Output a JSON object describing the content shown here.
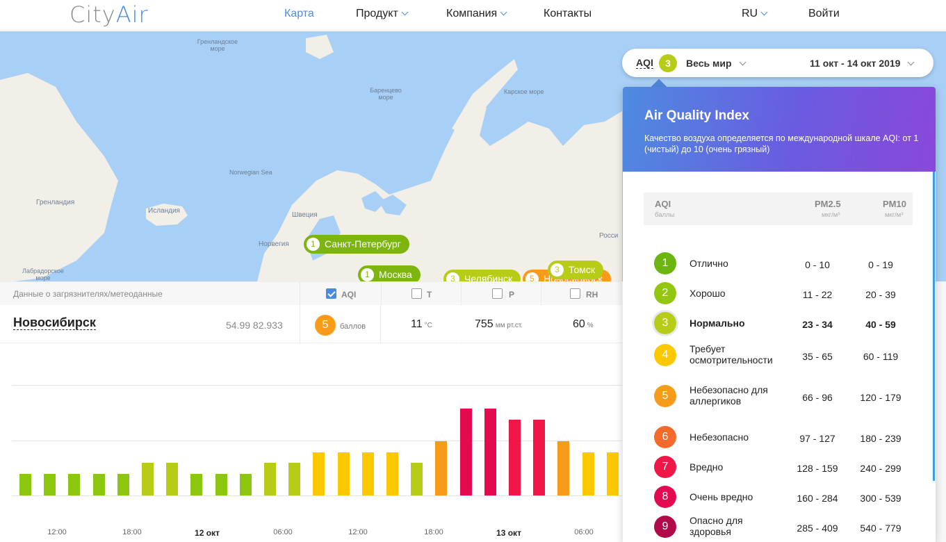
{
  "header": {
    "logo_city": "City",
    "logo_air": "Air",
    "nav": [
      {
        "label": "Карта",
        "active": true
      },
      {
        "label": "Продукт",
        "dropdown": true
      },
      {
        "label": "Компания",
        "dropdown": true
      },
      {
        "label": "Контакты"
      }
    ],
    "lang": "RU",
    "login": "Войти"
  },
  "map": {
    "labels": [
      {
        "text": "Гренландское море"
      },
      {
        "text": "Баренцево море"
      },
      {
        "text": "Карское море"
      },
      {
        "text": "Norwegian Sea"
      },
      {
        "text": "Гренландия"
      },
      {
        "text": "Исландия"
      },
      {
        "text": "Швеция"
      },
      {
        "text": "Норвегия"
      },
      {
        "text": "Лабрадорское море"
      },
      {
        "text": "Росси"
      }
    ],
    "cities": [
      {
        "aqi": "1",
        "name": "Санкт-Петербург",
        "color": "#7cb50f"
      },
      {
        "aqi": "1",
        "name": "Москва",
        "color": "#7cb50f"
      },
      {
        "aqi": "3",
        "name": "Челябинск",
        "color": "#b7cc17"
      },
      {
        "aqi": "3",
        "name": "Томск",
        "color": "#b7cc17"
      },
      {
        "aqi": "5",
        "name": "Новосибирск",
        "color": "#f89b1b"
      }
    ]
  },
  "selector": {
    "aqi_label": "AQI",
    "aqi_value": "3",
    "region": "Весь мир",
    "dates": "11 окт - 14 окт 2019"
  },
  "strip": {
    "label": "Данные о загрязнителях/метеоданные",
    "cols": [
      {
        "label": "AQI",
        "checked": true
      },
      {
        "label": "T",
        "checked": false
      },
      {
        "label": "P",
        "checked": false
      },
      {
        "label": "RH",
        "checked": false
      }
    ]
  },
  "row": {
    "city": "Новосибирск",
    "coords": "54.99 82.933",
    "aqi": "5",
    "aqi_unit": "баллов",
    "temp": "11",
    "temp_unit": "°С",
    "pressure": "755",
    "pressure_unit": "мм рт.ст.",
    "humidity": "60",
    "humidity_unit": "%"
  },
  "chart_data": {
    "type": "bar",
    "x_ticks": [
      "12:00",
      "18:00",
      "12 окт",
      "06:00",
      "12:00",
      "18:00",
      "13 окт",
      "06:00"
    ],
    "values": [
      2,
      2,
      2,
      2,
      2,
      3,
      3,
      2,
      2,
      2,
      3,
      3,
      4,
      4,
      4,
      4,
      3,
      5,
      8,
      8,
      7,
      7,
      5,
      4,
      4
    ],
    "colors": [
      "#8cc60f",
      "#8cc60f",
      "#8cc60f",
      "#8cc60f",
      "#8cc60f",
      "#b7cc17",
      "#b7cc17",
      "#8cc60f",
      "#8cc60f",
      "#8cc60f",
      "#b7cc17",
      "#b7cc17",
      "#fcc900",
      "#fcc900",
      "#fcc900",
      "#fcc900",
      "#b7cc17",
      "#f89b1b",
      "#e30a4f",
      "#e30a4f",
      "#f01646",
      "#f01646",
      "#f89b1b",
      "#fcc900",
      "#fcc900"
    ],
    "ylim": [
      0,
      10
    ]
  },
  "panel": {
    "title": "Air Quality Index",
    "desc": "Качество воздуха определяется по международной шкале AQI: от 1 (чистый) до 10 (очень грязный)",
    "col_aqi": "AQI",
    "col_aqi_sub": "баллы",
    "col_pm25": "PM2.5",
    "col_pm25_sub": "мкг/м³",
    "col_pm10": "PM10",
    "col_pm10_sub": "мкг/м³",
    "levels": [
      {
        "n": "1",
        "name": "Отлично",
        "pm25": "0 - 10",
        "pm10": "0 - 19",
        "color": "#6cb50f",
        "bold": false
      },
      {
        "n": "2",
        "name": "Хорошо",
        "pm25": "11 - 22",
        "pm10": "20 - 39",
        "color": "#93c60f",
        "bold": false
      },
      {
        "n": "3",
        "name": "Нормально",
        "pm25": "23 - 34",
        "pm10": "40 - 59",
        "color": "#b7cc17",
        "bold": true
      },
      {
        "n": "4",
        "name": "Требует осмотрительности",
        "pm25": "35 - 65",
        "pm10": "60 - 119",
        "color": "#fcc900",
        "bold": false
      },
      {
        "n": "5",
        "name": "Небезопасно для аллергиков",
        "pm25": "66 - 96",
        "pm10": "120 - 179",
        "color": "#f89b1b",
        "bold": false
      },
      {
        "n": "6",
        "name": "Небезопасно",
        "pm25": "97 - 127",
        "pm10": "180 - 239",
        "color": "#f46a2b",
        "bold": false
      },
      {
        "n": "7",
        "name": "Вредно",
        "pm25": "128 - 159",
        "pm10": "240 - 299",
        "color": "#f01646",
        "bold": false
      },
      {
        "n": "8",
        "name": "Очень вредно",
        "pm25": "160 - 284",
        "pm10": "300 - 539",
        "color": "#e30a4f",
        "bold": false
      },
      {
        "n": "9",
        "name": "Опасно для здоровья",
        "pm25": "285 - 409",
        "pm10": "540 - 779",
        "color": "#b10a4a",
        "bold": false
      }
    ]
  }
}
